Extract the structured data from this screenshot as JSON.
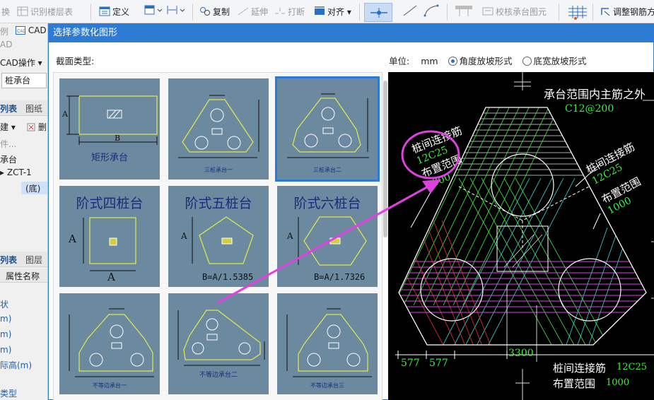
{
  "toolbar": {
    "items": [
      {
        "label": "换",
        "icon": "",
        "disabled": true
      },
      {
        "label": "识别楼层表",
        "icon": "grid-icon",
        "disabled": true
      },
      {
        "label": "定义",
        "icon": "define-icon",
        "disabled": false
      },
      {
        "label": "复制",
        "icon": "copy-icon",
        "disabled": false
      },
      {
        "label": "延伸",
        "icon": "extend-icon",
        "disabled": true
      },
      {
        "label": "打断",
        "icon": "break-icon",
        "disabled": true
      },
      {
        "label": "对齐",
        "icon": "align-icon",
        "disabled": false
      },
      {
        "label": "校核承台图元",
        "icon": "check-icon",
        "disabled": true
      },
      {
        "label": "调整钢筋方",
        "icon": "rebar-icon",
        "disabled": false
      }
    ]
  },
  "left_panel": {
    "row1": "例",
    "cad_label": "CAD",
    "row2": "AD",
    "cad_ops": "CAD操作",
    "combo_value": "桩承台",
    "tab_list": "列表",
    "tab_drawing": "图纸",
    "new_label": "建",
    "delete_label": "删",
    "search_hint": "件...",
    "tree_root": "承台",
    "tree_child": "ZCT-1",
    "tree_sub": "(底)",
    "tab_list2": "列表",
    "tab_layer": "图层",
    "prop_header": "属性名称",
    "prop_rows": [
      "状",
      "m)",
      "m)",
      "m)",
      "际高(m)"
    ],
    "bottom_item": "类型"
  },
  "dialog": {
    "title": "选择参数化图形",
    "section_label": "截面类型:",
    "unit_label": "单位:",
    "unit_value": "mm",
    "radio_angle": "角度放坡形式",
    "radio_width": "底宽放坡形式",
    "tiles": [
      {
        "name": "矩形承台",
        "style": "label"
      },
      {
        "name": "三桩承台一",
        "style": "small"
      },
      {
        "name": "三桩承台二",
        "style": "small",
        "selected": true
      },
      {
        "name": "阶式四桩台",
        "style": "big",
        "sublabel": "A",
        "formula": "A"
      },
      {
        "name": "阶式五桩台",
        "style": "big",
        "sublabel": "A",
        "formula": "B=A/1.5385"
      },
      {
        "name": "阶式六桩台",
        "style": "big",
        "sublabel": "A",
        "formula": "B=A/1.7326"
      },
      {
        "name": "不等边承台一",
        "style": "small"
      },
      {
        "name": "不等边承台二",
        "style": "small"
      },
      {
        "name": "不等边承台三",
        "style": "small"
      }
    ],
    "tile1_dim_a": "A",
    "tile1_dim_b": "B"
  },
  "preview": {
    "top_label": "承台范围内主筋之外",
    "top_rebar": "C12@200",
    "left_label": "桩间连接筋",
    "left_rebar": "12C25",
    "left_range": "布置范围",
    "left_range_value": "1000",
    "right_label": "桩间连接筋",
    "right_rebar": "12C25",
    "right_range": "布置范围",
    "right_range_value": "1000",
    "dim_577a": "577",
    "dim_577b": "577",
    "dim_3300": "3300",
    "bottom_label": "桩间连接筋",
    "bottom_rebar": "12C25",
    "bottom_range": "布置范围",
    "bottom_range_value": "1000"
  },
  "colors": {
    "accent": "#2e7bd3",
    "tile_bg": "#6b8aa0",
    "rebar_green": "#3cf03c",
    "highlight_magenta": "#e040e0"
  }
}
